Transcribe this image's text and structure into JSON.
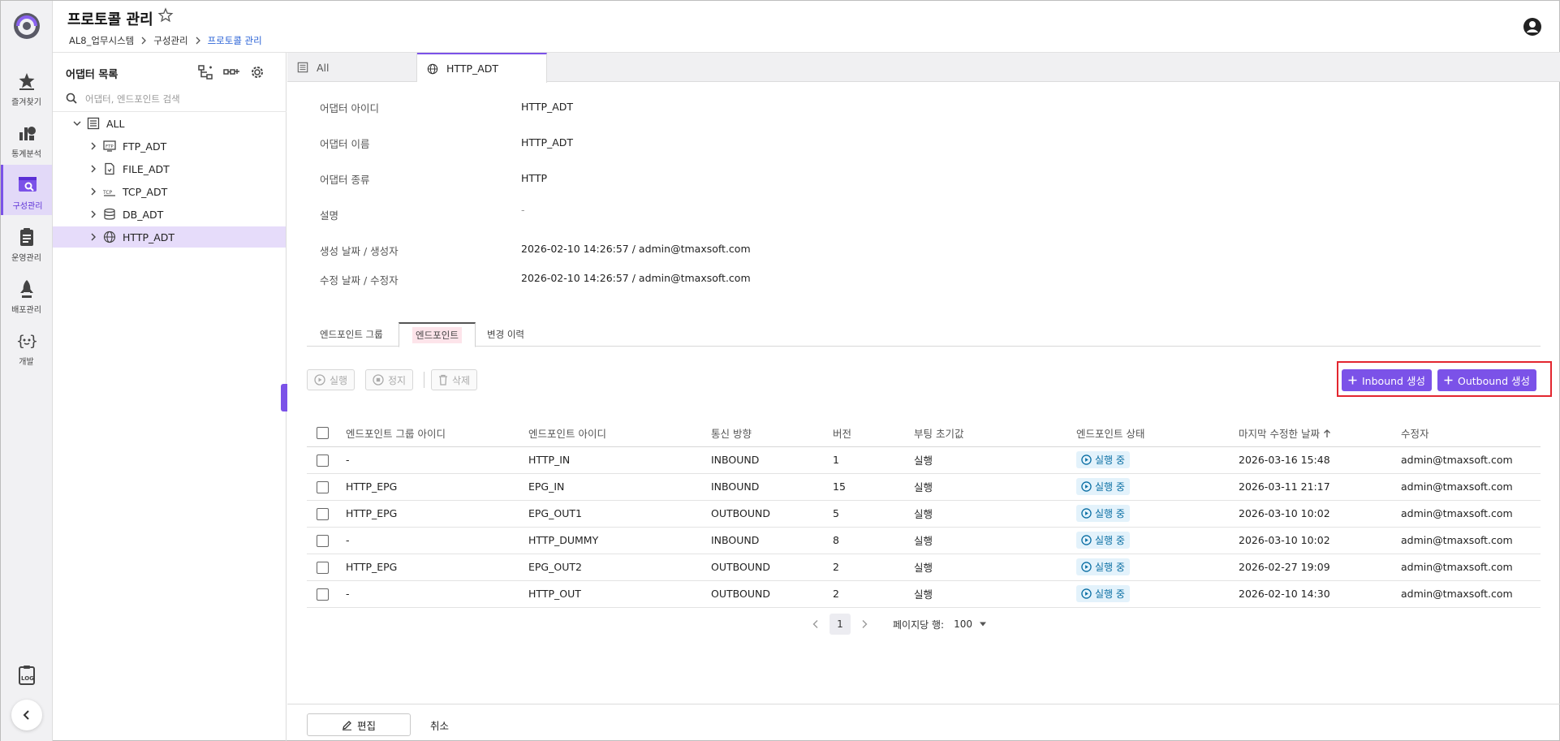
{
  "header": {
    "title": "프로토콜 관리",
    "breadcrumb": [
      "AL8_업무시스템",
      "구성관리",
      "프로토콜 관리"
    ]
  },
  "rail": {
    "items": [
      {
        "label": "즐겨찾기",
        "icon": "star-icon"
      },
      {
        "label": "통계분석",
        "icon": "chart-icon"
      },
      {
        "label": "구성관리",
        "icon": "config-icon",
        "active": true
      },
      {
        "label": "운영관리",
        "icon": "clipboard-icon"
      },
      {
        "label": "배포관리",
        "icon": "rocket-icon"
      },
      {
        "label": "개발",
        "icon": "code-icon"
      }
    ]
  },
  "tree": {
    "title": "어댑터 목록",
    "search_placeholder": "어댑터, 엔드포인트 검색",
    "root": "ALL",
    "nodes": [
      {
        "label": "FTP_ADT",
        "icon": "ftp-icon"
      },
      {
        "label": "FILE_ADT",
        "icon": "file-icon"
      },
      {
        "label": "TCP_ADT",
        "icon": "tcp-icon"
      },
      {
        "label": "DB_ADT",
        "icon": "database-icon"
      },
      {
        "label": "HTTP_ADT",
        "icon": "globe-icon",
        "selected": true
      }
    ]
  },
  "tabs": [
    {
      "label": "All",
      "icon": "list-icon"
    },
    {
      "label": "HTTP_ADT",
      "icon": "globe-icon",
      "active": true
    }
  ],
  "detail": {
    "rows": [
      {
        "key": "어댑터 아이디",
        "value": "HTTP_ADT"
      },
      {
        "key": "어댑터 이름",
        "value": "HTTP_ADT"
      },
      {
        "key": "어댑터 종류",
        "value": "HTTP"
      },
      {
        "key": "설명",
        "value": "-"
      },
      {
        "key": "생성 날짜 / 생성자",
        "value": "2026-02-10 14:26:57 / admin@tmaxsoft.com"
      },
      {
        "key": "수정 날짜 / 수정자",
        "value": "2026-02-10 14:26:57 / admin@tmaxsoft.com"
      }
    ]
  },
  "subtabs": [
    "엔드포인트 그룹",
    "엔드포인트",
    "변경 이력"
  ],
  "actions": {
    "run": "실행",
    "stop": "정지",
    "delete": "삭제",
    "inbound": "Inbound 생성",
    "outbound": "Outbound 생성"
  },
  "table": {
    "columns": [
      "엔드포인트 그룹 아이디",
      "엔드포인트 아이디",
      "통신 방향",
      "버전",
      "부팅 초기값",
      "엔드포인트 상태",
      "마지막 수정한 날짜",
      "수정자"
    ],
    "rows": [
      [
        "-",
        "HTTP_IN",
        "INBOUND",
        "1",
        "실행",
        "실행 중",
        "2026-03-16 15:48",
        "admin@tmaxsoft.com"
      ],
      [
        "HTTP_EPG",
        "EPG_IN",
        "INBOUND",
        "15",
        "실행",
        "실행 중",
        "2026-03-11 21:17",
        "admin@tmaxsoft.com"
      ],
      [
        "HTTP_EPG",
        "EPG_OUT1",
        "OUTBOUND",
        "5",
        "실행",
        "실행 중",
        "2026-03-10 10:02",
        "admin@tmaxsoft.com"
      ],
      [
        "-",
        "HTTP_DUMMY",
        "INBOUND",
        "8",
        "실행",
        "실행 중",
        "2026-03-10 10:02",
        "admin@tmaxsoft.com"
      ],
      [
        "HTTP_EPG",
        "EPG_OUT2",
        "OUTBOUND",
        "2",
        "실행",
        "실행 중",
        "2026-02-27 19:09",
        "admin@tmaxsoft.com"
      ],
      [
        "-",
        "HTTP_OUT",
        "OUTBOUND",
        "2",
        "실행",
        "실행 중",
        "2026-02-10 14:30",
        "admin@tmaxsoft.com"
      ]
    ]
  },
  "pagination": {
    "page": "1",
    "rows_per_page_label": "페이지당 행:",
    "rows_per_page": "100"
  },
  "footer": {
    "edit": "편집",
    "cancel": "취소"
  },
  "colors": {
    "accent": "#7b52e8",
    "highlight_border": "#e3262f",
    "status_bg": "#e3f2fb",
    "status_text": "#0b6fa4"
  }
}
